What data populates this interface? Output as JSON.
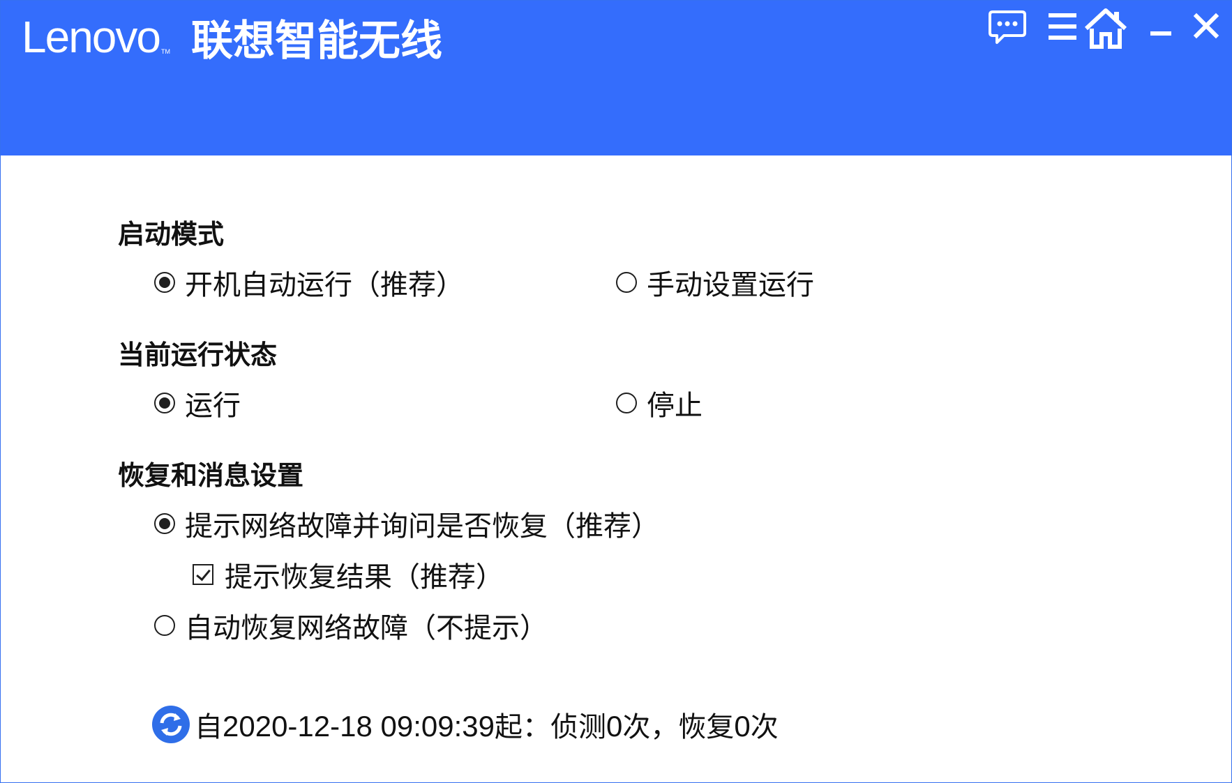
{
  "header": {
    "brand": "Lenovo",
    "brand_tm": "TM",
    "product_name": "联想智能无线",
    "background_color": "#346dfc",
    "controls": [
      {
        "name": "feedback-icon"
      },
      {
        "name": "menu-icon"
      },
      {
        "name": "home-icon"
      },
      {
        "name": "minimize-icon"
      },
      {
        "name": "close-icon"
      }
    ]
  },
  "startup_mode": {
    "title": "启动模式",
    "options": [
      {
        "label": "开机自动运行（推荐）",
        "checked": true
      },
      {
        "label": "手动设置运行",
        "checked": false
      }
    ]
  },
  "run_status": {
    "title": "当前运行状态",
    "options": [
      {
        "label": "运行",
        "checked": true
      },
      {
        "label": "停止",
        "checked": false
      }
    ]
  },
  "recovery": {
    "title": "恢复和消息设置",
    "options": [
      {
        "label": "提示网络故障并询问是否恢复（推荐）",
        "checked": true
      },
      {
        "label": "自动恢复网络故障（不提示）",
        "checked": false
      }
    ],
    "sub_checkbox": {
      "label": "提示恢复结果（推荐）",
      "checked": true
    }
  },
  "stats": {
    "prefix": "自",
    "datetime": "2020-12-18 09:09:39",
    "since": "起：侦测",
    "detect_count": "0",
    "detect_unit": "次，恢复",
    "recover_count": "0",
    "recover_unit": "次",
    "icon": "refresh-icon",
    "icon_color": "#2f6ee8"
  }
}
